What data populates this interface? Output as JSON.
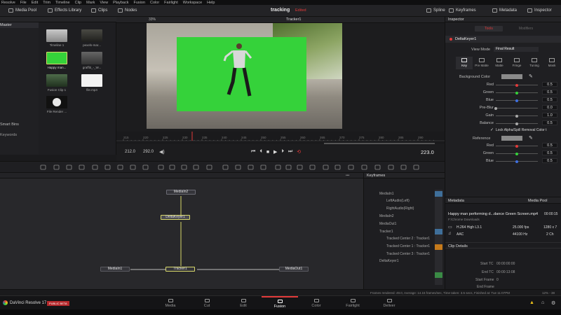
{
  "menubar": [
    "Resolve",
    "File",
    "Edit",
    "Trim",
    "Timeline",
    "Clip",
    "Mark",
    "View",
    "Playback",
    "Fusion",
    "Color",
    "Fairlight",
    "Workspace",
    "Help"
  ],
  "toolbar": {
    "media_pool": "Media Pool",
    "effects_library": "Effects Library",
    "clips": "Clips",
    "nodes": "Nodes",
    "project_title": "tracking",
    "project_status": "Edited",
    "spline": "Spline",
    "keyframes": "Keyframes",
    "metadata": "Metadata",
    "inspector": "Inspector"
  },
  "left": {
    "master": "Master",
    "smart_bins": "Smart Bins",
    "keywords": "Keywords",
    "clips": [
      {
        "label": "Timeline 1"
      },
      {
        "label": "pexels-mar..."
      },
      {
        "label": "Happy man..."
      },
      {
        "label": "graffiti_-_W..."
      },
      {
        "label": "Fusion Clip 1"
      },
      {
        "label": "file.mp4"
      },
      {
        "label": "File Render ..."
      }
    ]
  },
  "viewer": {
    "zoom": "33%",
    "viewer_name": "Tracker1",
    "time_in": "212.0",
    "time_out": "292.0",
    "current_frame": "223.0",
    "ruler_marks": [
      "215",
      "220",
      "225",
      "230",
      "235",
      "240",
      "245",
      "250",
      "255",
      "260",
      "265",
      "270",
      "275",
      "280",
      "285",
      "290"
    ]
  },
  "inspector": {
    "title": "Inspector",
    "tab_tools": "Tools",
    "tab_modifiers": "Modifiers",
    "node_name": "DeltaKeyer1",
    "view_mode_label": "View Mode",
    "view_mode_value": "Final Result",
    "subtabs": [
      "Key",
      "Pre Matte",
      "Matte",
      "Fringe",
      "Tuning",
      "Mask"
    ],
    "background_color_label": "Background Color",
    "params": [
      {
        "label": "Red",
        "value": "0.5"
      },
      {
        "label": "Green",
        "value": "0.5"
      },
      {
        "label": "Blue",
        "value": "0.5"
      },
      {
        "label": "Pre-Blur",
        "value": "0.0"
      },
      {
        "label": "Gain",
        "value": "1.0"
      },
      {
        "label": "Balance",
        "value": "0.5"
      }
    ],
    "lock_label": "Lock Alpha/Spill Removal Color t",
    "reference_label": "Reference",
    "ref_params": [
      {
        "label": "Red",
        "value": "0.5"
      },
      {
        "label": "Green",
        "value": "0.5"
      },
      {
        "label": "Blue",
        "value": "0.5"
      }
    ]
  },
  "nodes": {
    "items": [
      "MediaIn2",
      "DeltaKeyer1",
      "MediaIn1",
      "Tracker1",
      "MediaOut1"
    ]
  },
  "keyframes": {
    "title": "Keyframes",
    "items": [
      "MediaIn1",
      "LeftAudio(Left)",
      "RightAudio(Right)",
      "MediaIn2",
      "MediaOut1",
      "Tracker1",
      "Tracked Center 2 : Tracker1",
      "Tracked Center 1 : Tracker1",
      "Tracked Center 3 : Tracker1",
      "DeltaKeyer1"
    ]
  },
  "metadata": {
    "title": "Metadata",
    "media_pool": "Media Pool",
    "clip_name": "Happy man performing d...dance Green Screen.mp4",
    "duration": "00:00:15",
    "location": "F:\\Chrome Downloads",
    "video_codec": "H.264 High L3.1",
    "fps": "25.000 fps",
    "resolution": "1280 x 7",
    "audio_codec": "AAC",
    "audio_rate": "44100 Hz",
    "audio_channels": "2 Ch",
    "clip_details": "Clip Details",
    "start_tc_label": "Start TC",
    "start_tc": "00:00:00:00",
    "end_tc_label": "End TC",
    "end_tc": "00:00:13:08",
    "start_frame_label": "Start Frame",
    "start_frame": "0",
    "end_frame_label": "End Frame"
  },
  "status": {
    "text": "Frames rendered: 49.0,  Average: 14.15 frames/sec,  Time taken: 3.5 secs,  Finished at: Tue 11:07PM",
    "gpu": "12% - 38"
  },
  "pages": {
    "app_name": "DaVinci Resolve 17",
    "badge": "PUBLIC BETA",
    "tabs": [
      "Media",
      "Cut",
      "Edit",
      "Fusion",
      "Color",
      "Fairlight",
      "Deliver"
    ]
  },
  "colors": {
    "accent": "#e23a3a",
    "green_screen": "#35d23a",
    "node_link": "#d8d86a"
  }
}
